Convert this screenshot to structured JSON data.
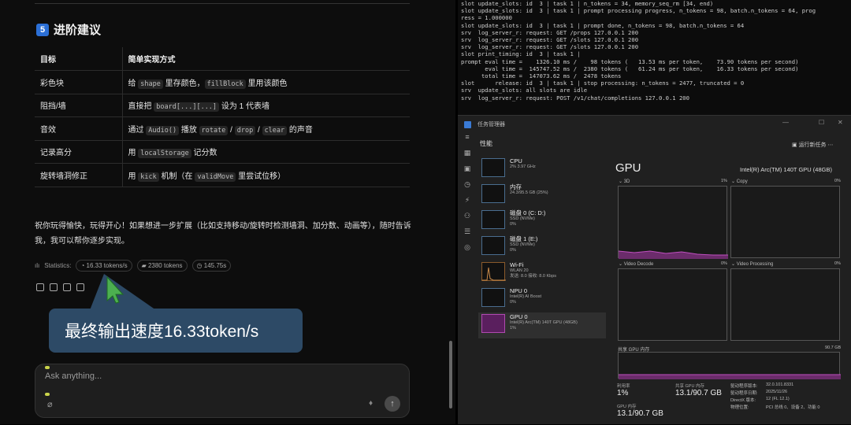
{
  "chat": {
    "section_num": "5",
    "section_title": "进阶建议",
    "table": {
      "headers": [
        "目标",
        "简单实现方式"
      ],
      "rows": [
        {
          "goal": "彩色块",
          "impl": [
            [
              "t",
              "给 "
            ],
            [
              "c",
              "shape"
            ],
            [
              "t",
              " 里存颜色，"
            ],
            [
              "c",
              "fillBlock"
            ],
            [
              "t",
              " 里用该颜色"
            ]
          ]
        },
        {
          "goal": "阻挡/墙",
          "impl": [
            [
              "t",
              "直接把 "
            ],
            [
              "c",
              "board[...][...]"
            ],
            [
              "t",
              " 设为 1 代表墙"
            ]
          ]
        },
        {
          "goal": "音效",
          "impl": [
            [
              "t",
              "通过 "
            ],
            [
              "c",
              "Audio()"
            ],
            [
              "t",
              " 播放 "
            ],
            [
              "c",
              "rotate"
            ],
            [
              "t",
              " / "
            ],
            [
              "c",
              "drop"
            ],
            [
              "t",
              " / "
            ],
            [
              "c",
              "clear"
            ],
            [
              "t",
              " 的声音"
            ]
          ]
        },
        {
          "goal": "记录高分",
          "impl": [
            [
              "t",
              "用 "
            ],
            [
              "c",
              "localStorage"
            ],
            [
              "t",
              " 记分数"
            ]
          ]
        },
        {
          "goal": "旋转墙洞修正",
          "impl": [
            [
              "t",
              "用 "
            ],
            [
              "c",
              "kick"
            ],
            [
              "t",
              " 机制（在 "
            ],
            [
              "c",
              "validMove"
            ],
            [
              "t",
              " 里尝试位移）"
            ]
          ]
        }
      ]
    },
    "paragraph": "祝你玩得愉快，玩得开心！如果想进一步扩展（比如支持移动/旋转时检测墙洞、加分数、动画等），随时告诉我，我可以帮你逐步实现。",
    "stats_label": "Statistics:",
    "stat_speed": "16.33 tokens/s",
    "stat_tokens": "2380 tokens",
    "stat_time": "145.75s",
    "callout": "最终输出速度16.33token/s",
    "input_placeholder": "Ask anything..."
  },
  "terminal": {
    "lines": [
      "slot update_slots: id  3 | task 1 | n_tokens = 34, memory_seq_rm [34, end)",
      "slot update_slots: id  3 | task 1 | prompt processing progress, n_tokens = 98, batch.n_tokens = 64, prog",
      "ress = 1.000000",
      "slot update_slots: id  3 | task 1 | prompt done, n_tokens = 98, batch.n_tokens = 64",
      "srv  log_server_r: request: GET /props 127.0.0.1 200",
      "srv  log_server_r: request: GET /slots 127.0.0.1 200",
      "srv  log_server_r: request: GET /slots 127.0.0.1 200",
      "slot print_timing: id  3 | task 1 |",
      "prompt eval time =    1326.10 ms /    98 tokens (   13.53 ms per token,    73.90 tokens per second)",
      "       eval time =  145747.52 ms /  2380 tokens (   61.24 ms per token,    16.33 tokens per second)",
      "      total time =  147073.62 ms /  2478 tokens",
      "slot      release: id  3 | task 1 | stop processing: n_tokens = 2477, truncated = 0",
      "srv  update_slots: all slots are idle",
      "srv  log_server_r: request: POST /v1/chat/completions 127.0.0.1 200"
    ]
  },
  "taskmgr": {
    "title": "任务管理器",
    "header": "性能",
    "run_task": "运行新任务",
    "processes": [
      {
        "name": "CPU",
        "sub1": "2%  3.97 GHz",
        "sub2": ""
      },
      {
        "name": "内存",
        "sub1": "24.3/95.5 GB (25%)",
        "sub2": ""
      },
      {
        "name": "磁盘 0 (C: D:)",
        "sub1": "SSD (NVMe)",
        "sub2": "0%"
      },
      {
        "name": "磁盘 1 (E:)",
        "sub1": "SSD (NVMe)",
        "sub2": "0%"
      },
      {
        "name": "Wi-Fi",
        "sub1": "WLAN 20",
        "sub2": "发送: 8.0  接收: 8.0 Kbps"
      },
      {
        "name": "NPU 0",
        "sub1": "Intel(R) AI Boost",
        "sub2": "0%"
      },
      {
        "name": "GPU 0",
        "sub1": "Intel(R) Arc(TM) 140T GPU (48GB)",
        "sub2": "1%"
      }
    ],
    "gpu_title": "GPU",
    "gpu_name": "Intel(R) Arc(TM) 140T GPU (48GB)",
    "graphs": [
      {
        "label": "3D",
        "pct": "1%"
      },
      {
        "label": "Copy",
        "pct": "0%"
      },
      {
        "label": "Video Decode",
        "pct": "0%"
      },
      {
        "label": "Video Processing",
        "pct": "0%"
      }
    ],
    "shared_mem_label": "共享 GPU 内存",
    "shared_mem_max": "90.7 GB",
    "util_label": "利用率",
    "util_value": "1%",
    "shared_label": "共享 GPU 内存",
    "shared_value": "13.1/90.7 GB",
    "gpu_mem_label": "GPU 内存",
    "gpu_mem_value": "13.1/90.7 GB",
    "driver_version_k": "驱动程序版本:",
    "driver_version_v": "32.0.101.8331",
    "driver_date_k": "驱动程序日期:",
    "driver_date_v": "2025/11/26",
    "directx_k": "DirectX 版本:",
    "directx_v": "12 (FL 12.1)",
    "location_k": "物理位置:",
    "location_v": "PCI 总线 0、设备 2、功能 0"
  }
}
